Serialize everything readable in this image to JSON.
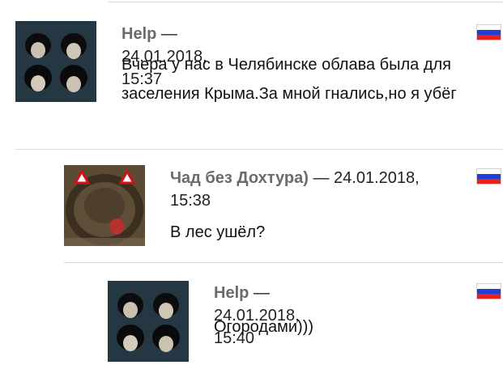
{
  "comments": [
    {
      "author": "Help",
      "separator": "—",
      "date": "24.01.2018, 15:37",
      "text": "Вчера у нас в Челябинске облава была для заселения Крыма.За мной гнались,но я убёг",
      "avatar_icon": "beatles-photo",
      "flag_icon": "russia-flag-icon"
    },
    {
      "author": "Чад без Дохтура)",
      "separator": "—",
      "date": "24.01.2018,",
      "date_cont": "15:38",
      "text": "В лес ушёл?",
      "avatar_icon": "hedgehog-photo",
      "flag_icon": "russia-flag-icon"
    },
    {
      "author": "Help",
      "separator": "—",
      "date": "24.01.2018, 15:40",
      "text": "Огородами)))",
      "avatar_icon": "beatles-photo",
      "flag_icon": "russia-flag-icon"
    }
  ],
  "colors": {
    "author": "#6b6b6b",
    "divider": "#dcdcdc",
    "flag_white": "#ffffff",
    "flag_blue": "#1c3fd6",
    "flag_red": "#e8201c"
  }
}
